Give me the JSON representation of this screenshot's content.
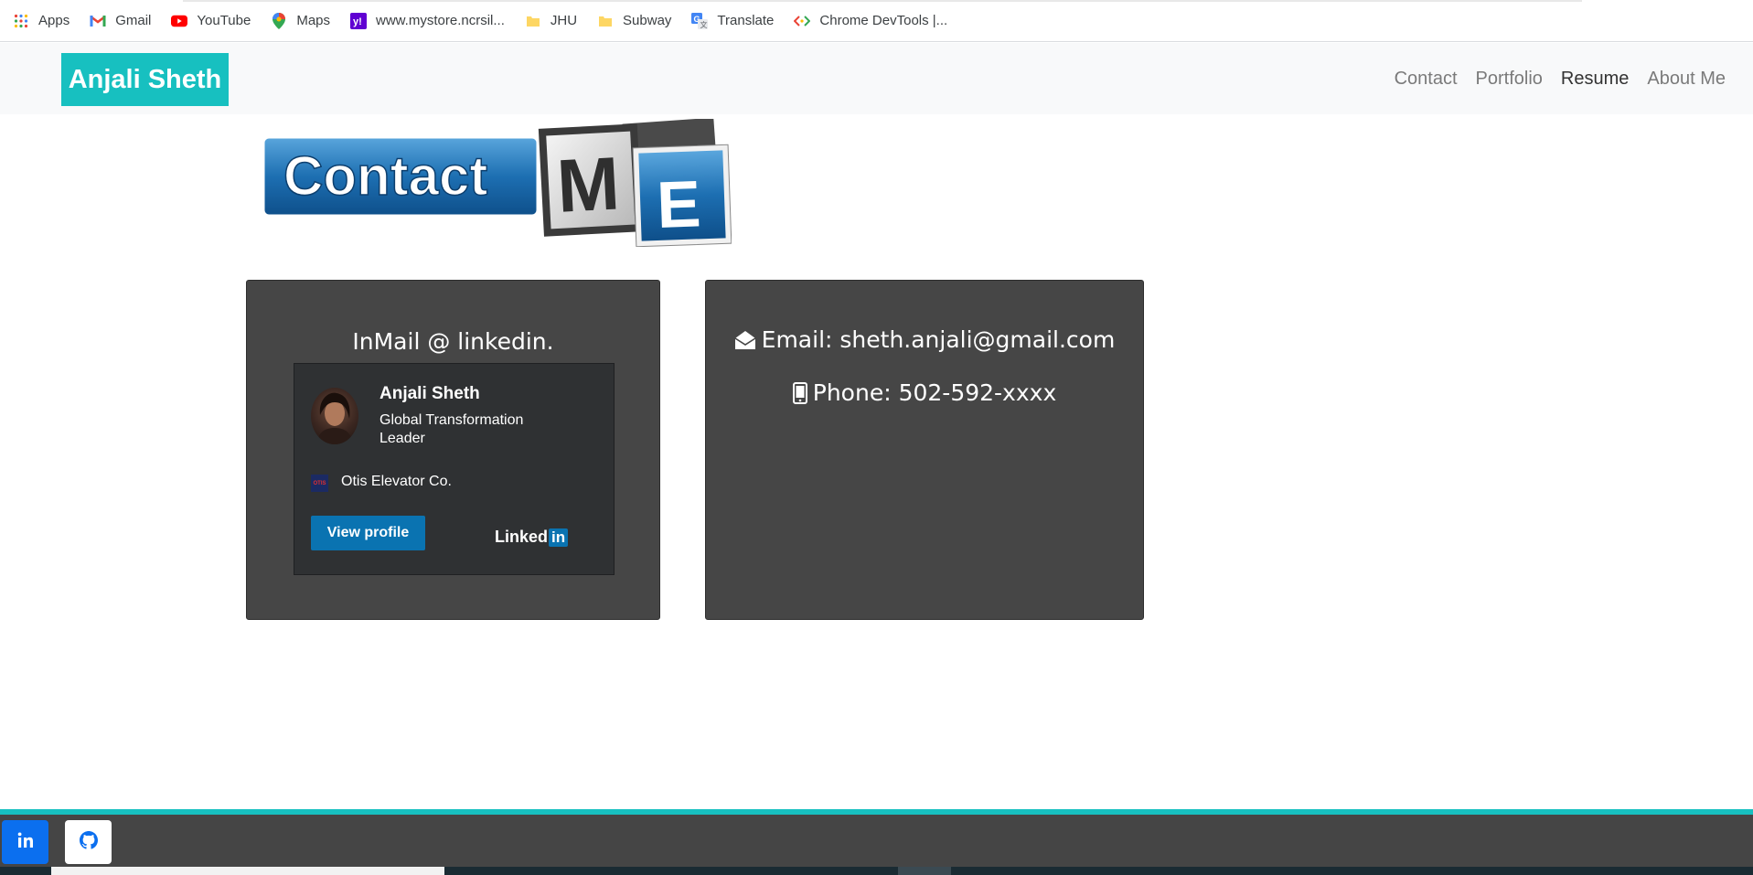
{
  "bookmarks": [
    {
      "label": "Apps",
      "icon": "apps-grid-icon"
    },
    {
      "label": "Gmail",
      "icon": "gmail-icon"
    },
    {
      "label": "YouTube",
      "icon": "youtube-icon"
    },
    {
      "label": "Maps",
      "icon": "maps-icon"
    },
    {
      "label": "www.mystore.ncrsil...",
      "icon": "yahoo-icon"
    },
    {
      "label": "JHU",
      "icon": "folder-icon"
    },
    {
      "label": "Subway",
      "icon": "folder-icon"
    },
    {
      "label": "Translate",
      "icon": "translate-icon"
    },
    {
      "label": "Chrome DevTools |...",
      "icon": "devtools-icon"
    }
  ],
  "navbar": {
    "brand": "Anjali Sheth",
    "brand_color": "#17c0c0",
    "links": [
      "Contact",
      "Portfolio",
      "Resume",
      "About Me"
    ],
    "active": "Resume"
  },
  "banner": {
    "word1": "Contact",
    "letter1": "M",
    "letter2": "E"
  },
  "linkedin_card": {
    "heading": "InMail @ linkedin.",
    "name": "Anjali Sheth",
    "title": "Global Transformation Leader",
    "company_logo_text": "OTIS",
    "company": "Otis Elevator Co.",
    "view_button": "View profile",
    "logo_text": "Linked",
    "logo_in": "in"
  },
  "contact_card": {
    "email": "Email: sheth.anjali@gmail.com",
    "phone": "Phone: 502-592-xxxx"
  },
  "footer": {
    "accent_color": "#17c0c0",
    "links": [
      {
        "name": "linkedin",
        "icon": "linkedin-icon"
      },
      {
        "name": "github",
        "icon": "github-icon"
      }
    ]
  }
}
